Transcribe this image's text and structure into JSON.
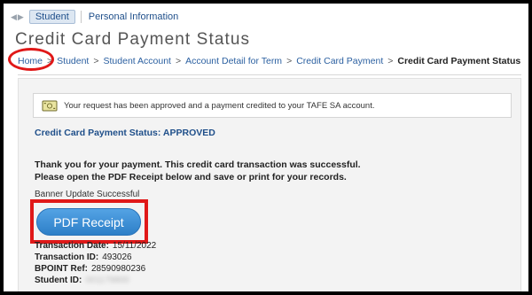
{
  "tabs": {
    "active": "Student",
    "other": "Personal Information"
  },
  "title": "Credit Card Payment Status",
  "breadcrumb": [
    {
      "label": "Home"
    },
    {
      "label": "Student"
    },
    {
      "label": "Student Account"
    },
    {
      "label": "Account Detail for Term"
    },
    {
      "label": "Credit Card Payment"
    },
    {
      "label": "Credit Card Payment Status"
    }
  ],
  "breadcrumb_separator": ">",
  "notice": {
    "text": "Your request has been approved and a payment credited to your TAFE SA account.",
    "icon": "money-note-icon"
  },
  "status": "Credit Card Payment Status: APPROVED",
  "thanks": {
    "line1": "Thank you for your payment. This credit card transaction was successful.",
    "line2": "Please open the PDF Receipt below and save or print for your records."
  },
  "banner_update": "Banner Update Successful",
  "pdf_button": "PDF Receipt",
  "details": {
    "transaction_date": {
      "label": "Transaction Date:",
      "value": "15/11/2022"
    },
    "transaction_id": {
      "label": "Transaction ID:",
      "value": "493026"
    },
    "bpoint_ref": {
      "label": "BPOINT Ref:",
      "value": "28590980236"
    },
    "student_id": {
      "label": "Student ID:",
      "value": "001179800"
    }
  },
  "colors": {
    "annotation": "#e01818",
    "link": "#2a5fa0",
    "button": "#2d7fc8"
  }
}
